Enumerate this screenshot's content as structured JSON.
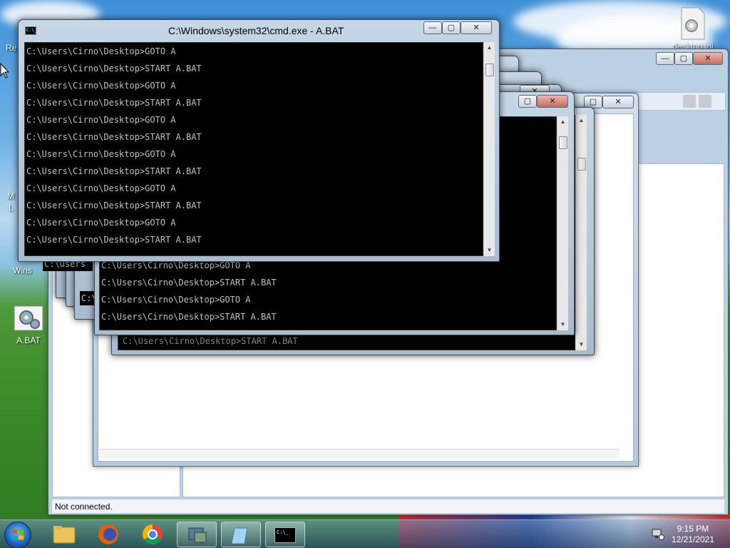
{
  "desktop": {
    "icons": [
      {
        "label": "A.BAT"
      },
      {
        "label": "desktop.ini"
      }
    ],
    "partial_labels": [
      "Re",
      "M",
      "L",
      "Wins"
    ]
  },
  "explorer": {
    "status_text": "Not connected."
  },
  "cmd_front": {
    "title": "C:\\Windows\\system32\\cmd.exe - A.BAT",
    "lines": [
      "C:\\Users\\Cirno\\Desktop>GOTO A",
      "C:\\Users\\Cirno\\Desktop>START A.BAT",
      "C:\\Users\\Cirno\\Desktop>GOTO A",
      "C:\\Users\\Cirno\\Desktop>START A.BAT",
      "C:\\Users\\Cirno\\Desktop>GOTO A",
      "C:\\Users\\Cirno\\Desktop>START A.BAT",
      "C:\\Users\\Cirno\\Desktop>GOTO A",
      "C:\\Users\\Cirno\\Desktop>START A.BAT",
      "C:\\Users\\Cirno\\Desktop>GOTO A",
      "C:\\Users\\Cirno\\Desktop>START A.BAT",
      "C:\\Users\\Cirno\\Desktop>GOTO A",
      "C:\\Users\\Cirno\\Desktop>START A.BAT"
    ]
  },
  "cmd_back": {
    "lines": [
      "C:\\Users\\Cirno\\Desktop>GOTO A",
      "C:\\Users\\Cirno\\Desktop>START A.BAT",
      "C:\\Users\\Cirno\\Desktop>GOTO A",
      "C:\\Users\\Cirno\\Desktop>START A.BAT"
    ],
    "cut_line": "C:\\Users\\Cirno\\Desktop>START A.BAT",
    "stacked_fragment": "C:\\Users"
  },
  "console_icon_text": "C:\\_",
  "caption_glyphs": {
    "minimize": "—",
    "maximize": "▢",
    "close": "✕"
  },
  "taskbar": {
    "time": "9:15 PM",
    "date": "12/21/2021",
    "pinned": [
      "windows-explorer",
      "firefox",
      "chrome",
      "control-panel",
      "notepad",
      "cmd"
    ]
  }
}
